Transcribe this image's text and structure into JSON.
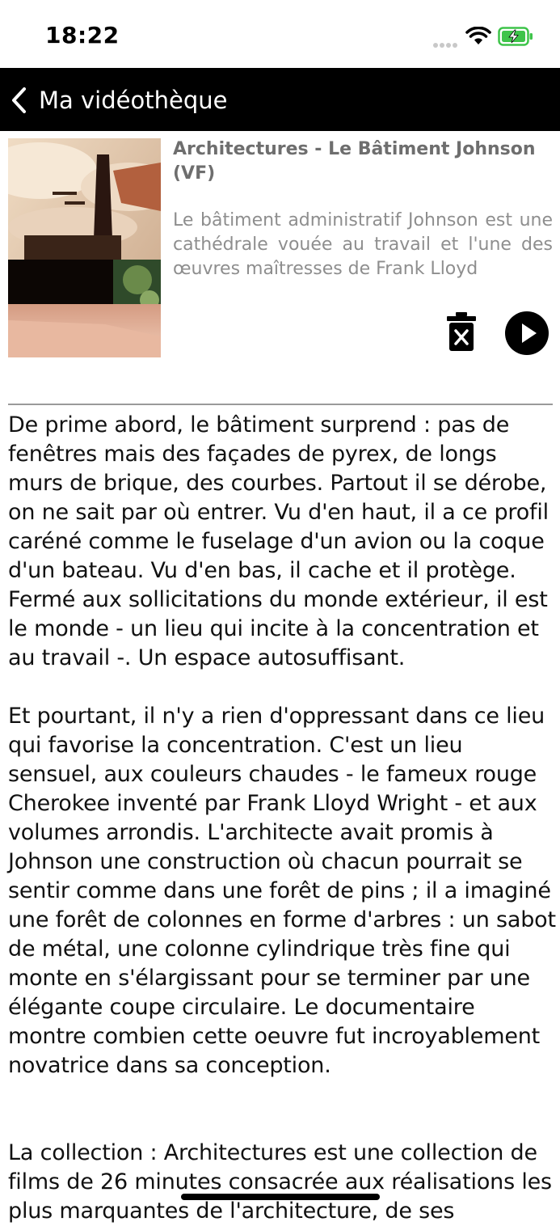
{
  "status_bar": {
    "time": "18:22",
    "icons": [
      "cellular-signal-icon",
      "wifi-icon",
      "battery-charging-icon"
    ],
    "battery_color": "#3ec44a"
  },
  "navbar": {
    "back_label": "Ma vidéothèque",
    "background": "#000000"
  },
  "video": {
    "thumbnail_alt": "Bâtiment Johnson interior",
    "title": "Architectures - Le Bâtiment Johnson (VF)",
    "description": "Le bâtiment administratif Johnson est une cathédrale vouée au travail et l'une des œuvres maîtresses de Frank Lloyd",
    "actions": [
      "delete-icon",
      "play-icon"
    ]
  },
  "content": {
    "paragraphs": [
      "De prime abord, le bâtiment surprend : pas de fenêtres mais des façades de pyrex, de longs murs de brique, des courbes. Partout il se dérobe, on ne sait par où entrer. Vu d'en haut, il a ce profil caréné comme le fuselage d'un avion ou la coque d'un bateau. Vu d'en bas, il cache et il protège. Fermé aux sollicitations du monde extérieur, il est le monde - un lieu qui incite à la concentration et au travail -. Un espace autosuffisant.",
      "Et pourtant, il n'y a rien d'oppressant dans ce lieu qui favorise la concentration. C'est un lieu sensuel, aux couleurs chaudes - le fameux rouge Cherokee inventé par Frank Lloyd Wright - et aux volumes arrondis. L'architecte avait promis à Johnson une construction où chacun pourrait se sentir comme dans une forêt de pins ; il a imaginé une forêt de colonnes en forme d'arbres : un sabot de métal, une colonne cylindrique très fine qui monte en s'élargissant pour se terminer par une élégante coupe circulaire. Le documentaire montre combien cette oeuvre fut incroyablement novatrice dans sa conception.",
      "La collection : Architectures est une collection de films de 26 minutes consacrée aux réalisations les plus marquantes de l'architecture, de ses"
    ]
  }
}
